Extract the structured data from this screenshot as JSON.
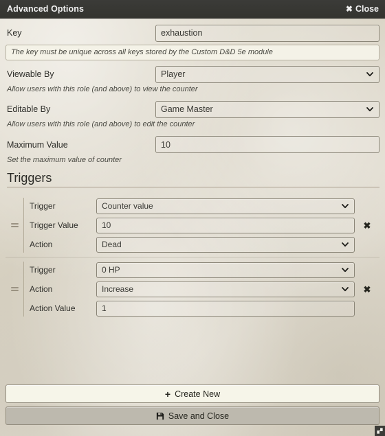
{
  "titlebar": {
    "title": "Advanced Options",
    "close_label": "Close",
    "close_icon": "close-x-icon"
  },
  "form": {
    "key": {
      "label": "Key",
      "value": "exhaustion",
      "hint": "The key must be unique across all keys stored by the Custom D&D 5e module"
    },
    "viewable_by": {
      "label": "Viewable By",
      "value": "Player",
      "hint": "Allow users with this role (and above) to view the counter"
    },
    "editable_by": {
      "label": "Editable By",
      "value": "Game Master",
      "hint": "Allow users with this role (and above) to edit the counter"
    },
    "maximum_value": {
      "label": "Maximum Value",
      "value": "10",
      "hint": "Set the maximum value of counter"
    }
  },
  "triggers_section": {
    "heading": "Triggers",
    "groups": [
      {
        "grip_icon": "drag-handle-icon",
        "delete_icon": "close-x-icon",
        "rows": [
          {
            "label": "Trigger",
            "value": "Counter value",
            "type": "select"
          },
          {
            "label": "Trigger Value",
            "value": "10",
            "type": "text"
          },
          {
            "label": "Action",
            "value": "Dead",
            "type": "select"
          }
        ]
      },
      {
        "grip_icon": "drag-handle-icon",
        "delete_icon": "close-x-icon",
        "rows": [
          {
            "label": "Trigger",
            "value": "0 HP",
            "type": "select"
          },
          {
            "label": "Action",
            "value": "Increase",
            "type": "select"
          },
          {
            "label": "Action Value",
            "value": "1",
            "type": "text"
          }
        ]
      }
    ]
  },
  "footer": {
    "create_new_label": "Create New",
    "create_new_icon": "plus-icon",
    "save_label": "Save and Close",
    "save_icon": "floppy-disk-icon"
  },
  "colors": {
    "titlebar_bg": "#34342f",
    "window_bg": "#ded8ca",
    "accent_rule": "#a89c8c",
    "create_btn_bg": "#f6f5e9",
    "save_btn_bg": "#bdb9ae"
  }
}
